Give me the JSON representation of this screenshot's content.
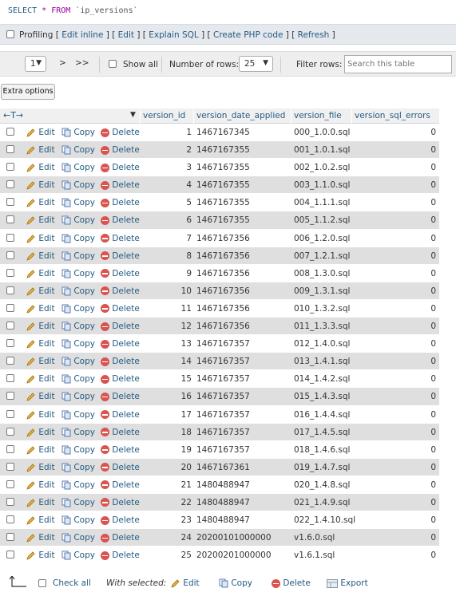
{
  "query": {
    "select": "SELECT",
    "star": "*",
    "from": "FROM",
    "table": "`ip_versions`"
  },
  "profiling": {
    "label": "Profiling",
    "open_bracket_1": "[",
    "edit_inline": "Edit inline",
    "sep_1": "] [",
    "edit": "Edit",
    "sep_2": "] [",
    "explain_sql": "Explain SQL",
    "sep_3": "] [",
    "create_php": "Create PHP code",
    "sep_4": "] [",
    "refresh": "Refresh",
    "close_bracket": "]"
  },
  "navigation": {
    "page_value": "1",
    "next": ">",
    "last": ">>",
    "show_all": "Show all",
    "rows_label": "Number of rows:",
    "rows_value": "25",
    "filter_label": "Filter rows:",
    "search_placeholder": "Search this table"
  },
  "extra_options": "Extra options",
  "table": {
    "columns": [
      "version_id",
      "version_date_applied",
      "version_file",
      "version_sql_errors"
    ],
    "actions": {
      "edit": "Edit",
      "copy": "Copy",
      "delete": "Delete"
    },
    "rows": [
      {
        "id": "1",
        "date": "1467167345",
        "file": "000_1.0.0.sql",
        "errors": "0"
      },
      {
        "id": "2",
        "date": "1467167355",
        "file": "001_1.0.1.sql",
        "errors": "0"
      },
      {
        "id": "3",
        "date": "1467167355",
        "file": "002_1.0.2.sql",
        "errors": "0"
      },
      {
        "id": "4",
        "date": "1467167355",
        "file": "003_1.1.0.sql",
        "errors": "0"
      },
      {
        "id": "5",
        "date": "1467167355",
        "file": "004_1.1.1.sql",
        "errors": "0"
      },
      {
        "id": "6",
        "date": "1467167355",
        "file": "005_1.1.2.sql",
        "errors": "0"
      },
      {
        "id": "7",
        "date": "1467167356",
        "file": "006_1.2.0.sql",
        "errors": "0"
      },
      {
        "id": "8",
        "date": "1467167356",
        "file": "007_1.2.1.sql",
        "errors": "0"
      },
      {
        "id": "9",
        "date": "1467167356",
        "file": "008_1.3.0.sql",
        "errors": "0"
      },
      {
        "id": "10",
        "date": "1467167356",
        "file": "009_1.3.1.sql",
        "errors": "0"
      },
      {
        "id": "11",
        "date": "1467167356",
        "file": "010_1.3.2.sql",
        "errors": "0"
      },
      {
        "id": "12",
        "date": "1467167356",
        "file": "011_1.3.3.sql",
        "errors": "0"
      },
      {
        "id": "13",
        "date": "1467167357",
        "file": "012_1.4.0.sql",
        "errors": "0"
      },
      {
        "id": "14",
        "date": "1467167357",
        "file": "013_1.4.1.sql",
        "errors": "0"
      },
      {
        "id": "15",
        "date": "1467167357",
        "file": "014_1.4.2.sql",
        "errors": "0"
      },
      {
        "id": "16",
        "date": "1467167357",
        "file": "015_1.4.3.sql",
        "errors": "0"
      },
      {
        "id": "17",
        "date": "1467167357",
        "file": "016_1.4.4.sql",
        "errors": "0"
      },
      {
        "id": "18",
        "date": "1467167357",
        "file": "017_1.4.5.sql",
        "errors": "0"
      },
      {
        "id": "19",
        "date": "1467167357",
        "file": "018_1.4.6.sql",
        "errors": "0"
      },
      {
        "id": "20",
        "date": "1467167361",
        "file": "019_1.4.7.sql",
        "errors": "0"
      },
      {
        "id": "21",
        "date": "1480488947",
        "file": "020_1.4.8.sql",
        "errors": "0"
      },
      {
        "id": "22",
        "date": "1480488947",
        "file": "021_1.4.9.sql",
        "errors": "0"
      },
      {
        "id": "23",
        "date": "1480488947",
        "file": "022_1.4.10.sql",
        "errors": "0"
      },
      {
        "id": "24",
        "date": "20200101000000",
        "file": "v1.6.0.sql",
        "errors": "0"
      },
      {
        "id": "25",
        "date": "20200201000000",
        "file": "v1.6.1.sql",
        "errors": "0"
      }
    ]
  },
  "footer": {
    "check_all": "Check all",
    "with_selected": "With selected:",
    "edit": "Edit",
    "copy": "Copy",
    "delete": "Delete",
    "export": "Export"
  }
}
